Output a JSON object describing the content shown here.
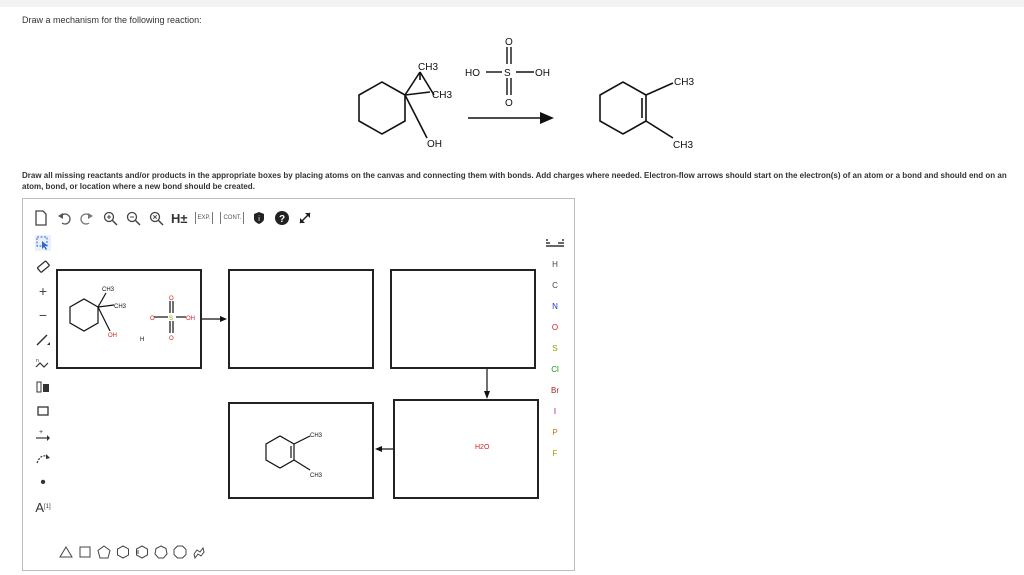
{
  "question": {
    "prompt": "Draw a mechanism for the following reaction:",
    "instructions": "Draw all missing reactants and/or products in the appropriate boxes by placing atoms on the canvas and connecting them with bonds. Add charges where needed. Electron-flow arrows should start on the electron(s) of an atom or a bond and should end on an atom, bond, or location where a new bond should be created."
  },
  "reaction": {
    "reactant_methyl_top": "CH3",
    "reactant_methyl_side": "CH3",
    "reactant_hydroxyl": "OH",
    "reagent_left": "HO",
    "reagent_center": "S",
    "reagent_right": "OH",
    "reagent_oxygen_top": "O",
    "reagent_oxygen_bottom": "O",
    "product_methyl_top": "CH3",
    "product_methyl_bottom": "CH3"
  },
  "toolbar_top": {
    "h_plus_label": "H±",
    "exp_label": "EXP.",
    "cont_label": "CONT."
  },
  "toolbar_left": {
    "label_tool": "A",
    "label_tool_superscript": "[1]"
  },
  "elements": [
    "H",
    "C",
    "N",
    "O",
    "S",
    "Cl",
    "Br",
    "I",
    "P",
    "F"
  ],
  "element_colors": {
    "H": "#444444",
    "C": "#444444",
    "N": "#2233cc",
    "O": "#cc2222",
    "S": "#999900",
    "Cl": "#119911",
    "Br": "#992222",
    "I": "#991199",
    "P": "#cc7700",
    "F": "#aa9900"
  },
  "canvas": {
    "box1_methyl_top": "CH3",
    "box1_methyl_side": "CH3",
    "box1_hydroxyl": "OH",
    "box1_h_label": "H",
    "box1_o_left": "O",
    "box1_s_label": "S",
    "box1_oh_right": "OH",
    "box1_o_top": "O",
    "box1_o_bottom": "O",
    "box5_water": "H2O",
    "box6_methyl_top": "CH3",
    "box6_methyl_bottom": "CH3"
  }
}
